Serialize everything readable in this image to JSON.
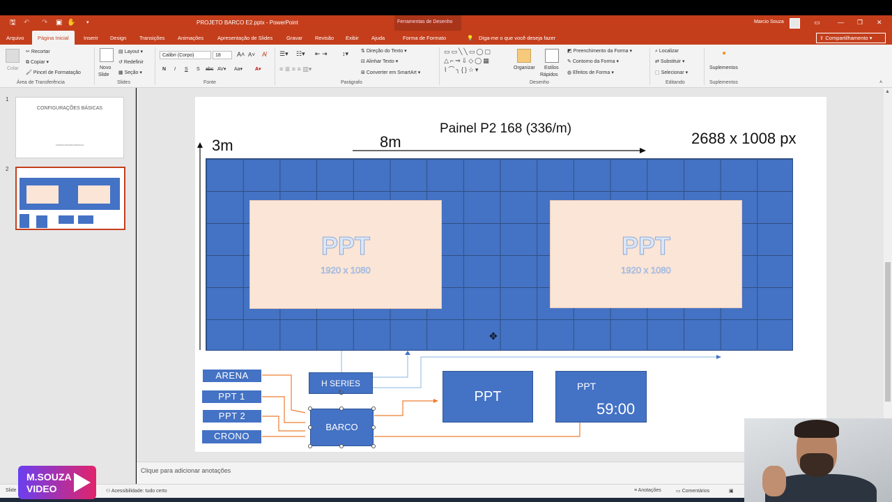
{
  "app": {
    "title": "PROJETO BARCO E2.pptx  -  PowerPoint",
    "tools_context": "Ferramentas de Desenho",
    "user": "Marcio Souza"
  },
  "tabs": [
    {
      "label": "Arquivo"
    },
    {
      "label": "Página Inicial",
      "active": true
    },
    {
      "label": "Inserir"
    },
    {
      "label": "Design"
    },
    {
      "label": "Transições"
    },
    {
      "label": "Animações"
    },
    {
      "label": "Apresentação de Slides"
    },
    {
      "label": "Gravar"
    },
    {
      "label": "Revisão"
    },
    {
      "label": "Exibir"
    },
    {
      "label": "Ajuda"
    },
    {
      "label": "Forma de Formato"
    }
  ],
  "tellme": "Diga-me o que você deseja fazer",
  "share_label": "Compartilhamento",
  "ribbon": {
    "clipboard": {
      "paste": "Colar",
      "cut": "Recortar",
      "copy": "Copiar",
      "painter": "Pincel de Formatação",
      "group": "Área de Transferência"
    },
    "slides": {
      "new": "Novo",
      "new2": "Slide",
      "layout": "Layout",
      "reset": "Redefinir",
      "section": "Seção",
      "group": "Slides"
    },
    "font": {
      "name": "Calibri (Corpo)",
      "size": "18",
      "group": "Fonte"
    },
    "paragraph": {
      "direction": "Direção do Texto",
      "align": "Alinhar Texto",
      "smartart": "Converter em SmartArt",
      "group": "Parágrafo"
    },
    "drawing": {
      "arrange": "Organizar",
      "styles1": "Estilos",
      "styles2": "Rápidos",
      "fill": "Preenchimento da Forma",
      "outline": "Contorno da Forma",
      "effects": "Efeitos de Forma",
      "group": "Desenho"
    },
    "editing": {
      "find": "Localizar",
      "replace": "Substituir",
      "select": "Selecionar",
      "group": "Editando"
    },
    "addins": {
      "label": "Suplementos",
      "group": "Suplementos"
    }
  },
  "thumbnails": [
    {
      "num": "1",
      "title": "CONFIGURAÇÕES BÁSICAS",
      "subtitle": "CONFIGURAÇÕES BÁSICAS"
    },
    {
      "num": "2",
      "selected": true
    }
  ],
  "slide": {
    "panel_title": "Painel P2 168 (336/m)",
    "height_label": "3m",
    "width_label": "8m",
    "resolution": "2688 x 1008 px",
    "ppt_left": {
      "title": "PPT",
      "res": "1920 x 1080"
    },
    "ppt_right": {
      "title": "PPT",
      "res": "1920 x 1080"
    },
    "inputs": [
      "ARENA",
      "PPT 1",
      "PPT 2",
      "CRONO"
    ],
    "hseries": "H SERIES",
    "barco": "BARCO",
    "out_ppt": "PPT",
    "out_ppt2": "PPT",
    "timer": "59:00"
  },
  "notes_placeholder": "Clique para adicionar anotações",
  "status": {
    "slide": "Slide",
    "accessibility": "Acessibilidade: tudo certo",
    "notes": "Anotações",
    "comments": "Comentários"
  },
  "brand": {
    "line1": "M.SOUZA",
    "line2": "VIDEO"
  },
  "colors": {
    "accent": "#c43e1c",
    "led_blue": "#4472c4",
    "ppt_fill": "#fbe5d6",
    "arrow_orange": "#ed7d31"
  }
}
